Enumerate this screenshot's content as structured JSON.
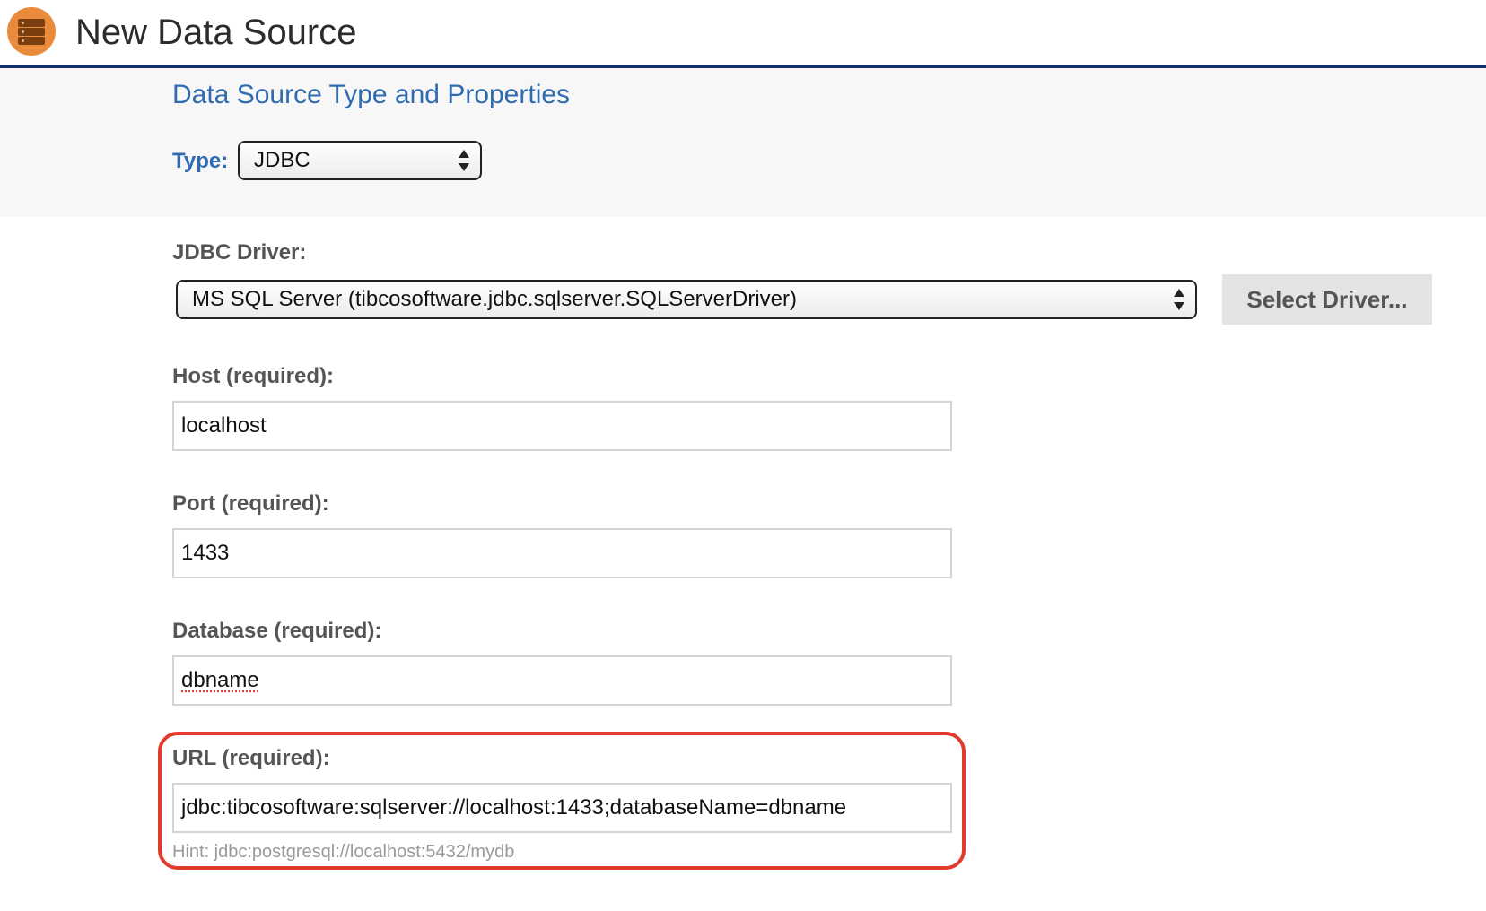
{
  "header": {
    "title": "New Data Source",
    "icon": "database-icon",
    "icon_color": "#e98b3a",
    "rule_color": "#14306b"
  },
  "type_section": {
    "title": "Data Source Type and Properties",
    "type_label": "Type:",
    "type_value": "JDBC"
  },
  "form": {
    "driver_label": "JDBC Driver:",
    "driver_value": "MS SQL Server (tibcosoftware.jdbc.sqlserver.SQLServerDriver)",
    "select_driver_button": "Select Driver...",
    "host_label": "Host (required):",
    "host_value": "localhost",
    "port_label": "Port (required):",
    "port_value": "1433",
    "database_label": "Database (required):",
    "database_value": "dbname",
    "url_label": "URL (required):",
    "url_value": "jdbc:tibcosoftware:sqlserver://localhost:1433;databaseName=dbname",
    "url_hint": "Hint: jdbc:postgresql://localhost:5432/mydb"
  },
  "colors": {
    "accent_blue": "#2e6bb0",
    "highlight_red": "#e03b2c"
  }
}
